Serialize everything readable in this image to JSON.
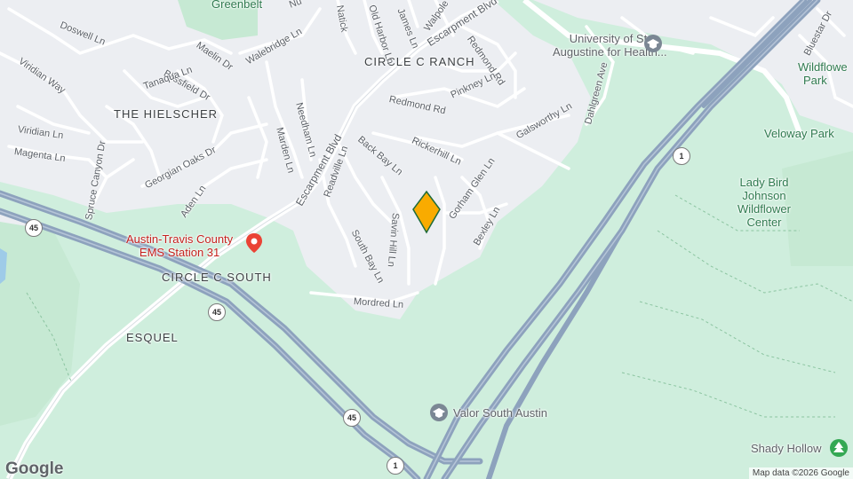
{
  "map": {
    "neighborhoods": [
      "CIRCLE C RANCH",
      "THE HIELSCHER",
      "CIRCLE C SOUTH",
      "ESQUEL"
    ],
    "streets": {
      "escarpment_upper": "Escarpment Blvd",
      "escarpment_lower": "Escarpment Blvd",
      "doswell": "Doswell Ln",
      "viridian_way": "Viridian Way",
      "viridian_ln": "Viridian Ln",
      "magenta": "Magenta Ln",
      "maelin": "Maelin Dr",
      "blissfield": "Blissfield Dr",
      "tanaqua": "Tanaqua Ln",
      "walebridge": "Walebridge Ln",
      "needham": "Needham Ln",
      "marden": "Marden Ln",
      "georgian_oaks": "Georgian Oaks Dr",
      "spruce_canyon": "Spruce Canyon Dr",
      "aden": "Aden Ln",
      "back_bay": "Back Bay Ln",
      "readville": "Readville Ln",
      "rickerhill": "Rickerhill Ln",
      "redmond_rd": "Redmond Rd",
      "redmond_rd2": "Redmond Rd",
      "pinkney": "Pinkney Ln",
      "galsworthy": "Galsworthy Ln",
      "dahlgreen": "Dahlgreen Ave",
      "gorham_glen": "Gorham Glen Ln",
      "bexley": "Bexley Ln",
      "savin_hill": "Savin Hill Ln",
      "south_bay": "South Bay Ln",
      "mordred": "Mordred Ln",
      "walpole": "Walpole",
      "old_harbor": "Old Harbor Ln",
      "natick": "Natick",
      "james": "James Ln",
      "bluestar": "Bluestar Dr",
      "nu": "Nu"
    },
    "pois": {
      "greenbelt": "Greenbelt",
      "university_line1": "University of St.",
      "university_line2": "Augustine for Health...",
      "wildflower_park_1": "Wildflowe",
      "wildflower_park_2": "Park",
      "veloway": "Veloway Park",
      "ladybird_1": "Lady Bird",
      "ladybird_2": "Johnson",
      "ladybird_3": "Wildflower",
      "ladybird_4": "Center",
      "ems_1": "Austin-Travis County",
      "ems_2": "EMS Station 31",
      "valor": "Valor South Austin",
      "shady_hollow": "Shady Hollow"
    },
    "shields": {
      "sh45_a": "45",
      "sh45_b": "45",
      "sh45_c": "45",
      "loop1_a": "1",
      "loop1_b": "1"
    },
    "logo": "Google",
    "attribution": "Map data ©2026 Google"
  },
  "colors": {
    "park": "#cfeedd",
    "urban": "#eceef2",
    "highway": "#8da2bd",
    "road": "#ffffff",
    "marker": "#f9ab00",
    "poi_green": "#2f7a4f",
    "poi_red": "#ea4335"
  },
  "icons": [
    "location-pin-icon",
    "graduation-cap-icon",
    "map-pin-icon",
    "tree-icon"
  ]
}
